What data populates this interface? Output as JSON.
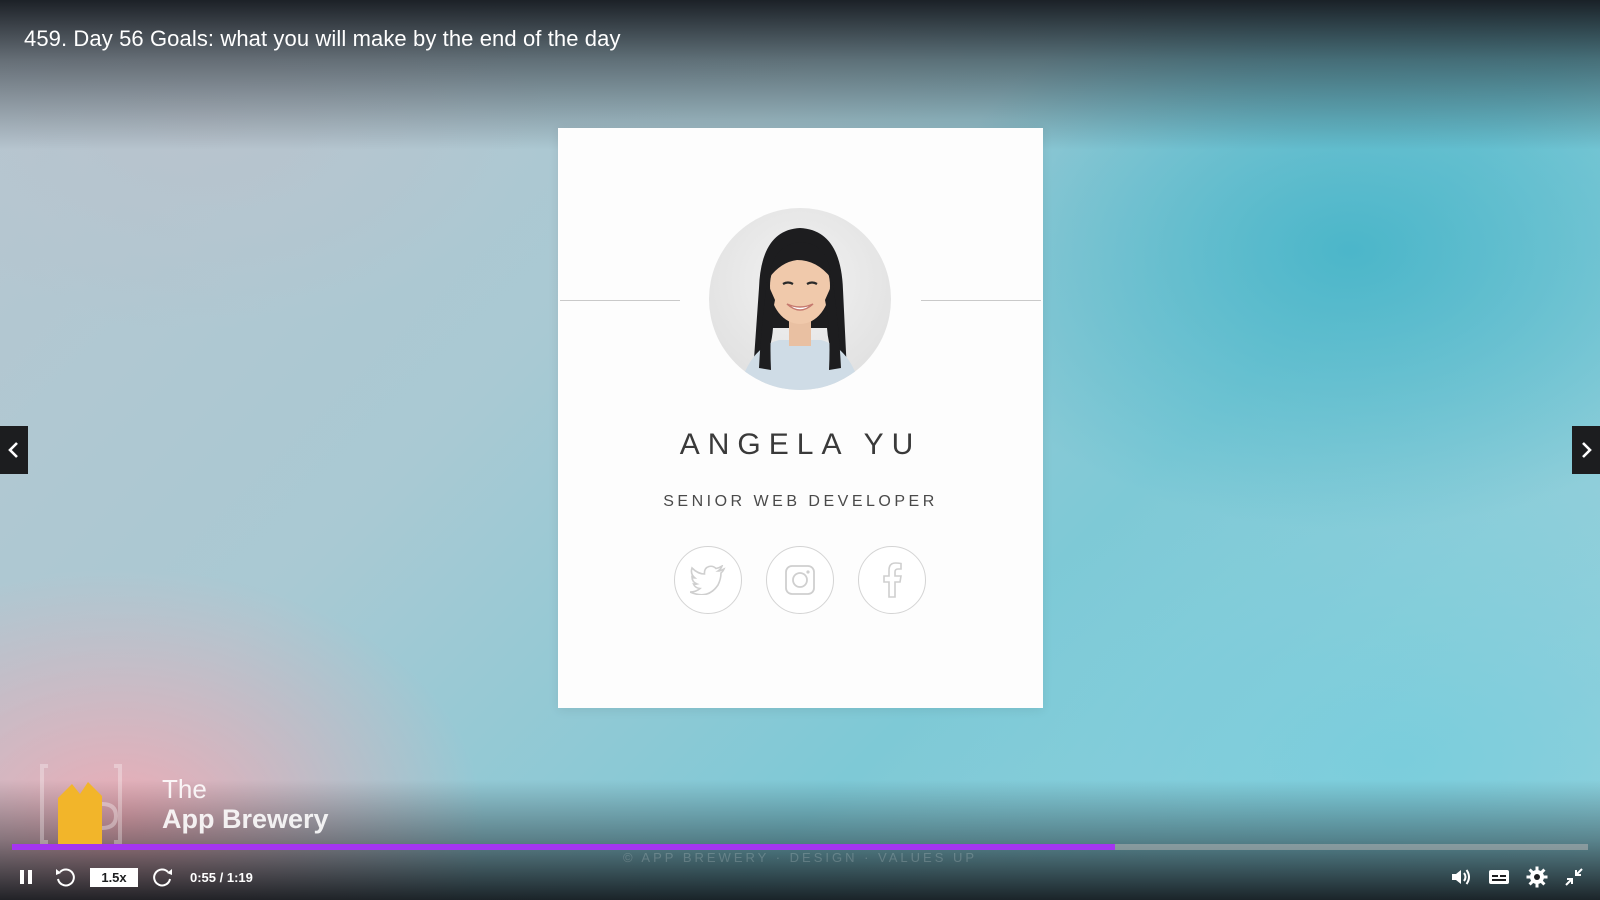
{
  "lecture": {
    "title": "459. Day 56 Goals: what you will make by the end of the day"
  },
  "card": {
    "name": "ANGELA YU",
    "role": "SENIOR WEB DEVELOPER",
    "social": [
      "twitter-icon",
      "instagram-icon",
      "facebook-icon"
    ]
  },
  "watermark": {
    "line1": "The",
    "line2": "App Brewery",
    "copyright": "© APP BREWERY · DESIGN · VALUES UP"
  },
  "player": {
    "speed_label": "1.5x",
    "time_label": "0:55 / 1:19",
    "progress": 0.7,
    "accent_color": "#a435f0",
    "icons": [
      "pause-icon",
      "rewind-icon",
      "forward-icon",
      "volume-icon",
      "captions-icon",
      "settings-icon",
      "exit-fullscreen-icon"
    ]
  }
}
